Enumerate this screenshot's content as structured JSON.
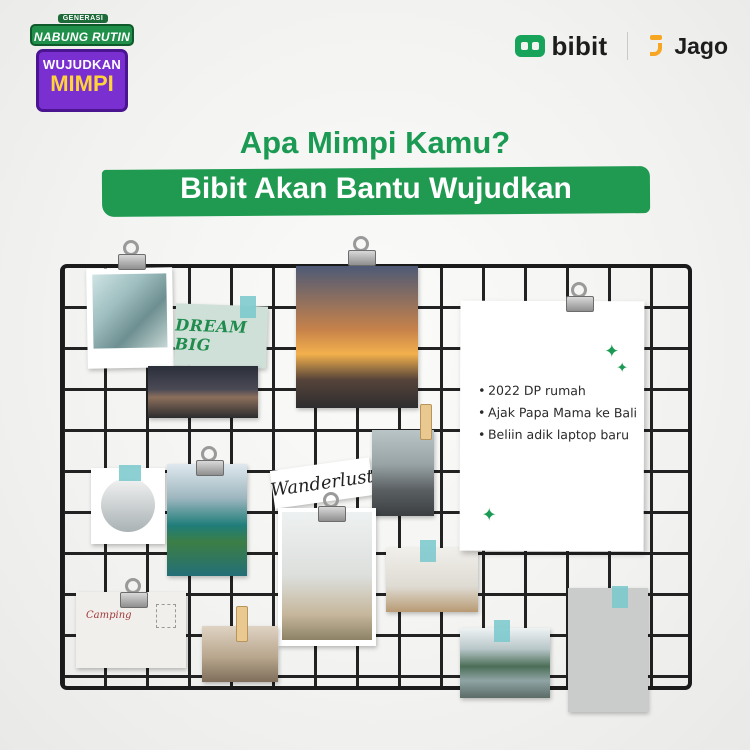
{
  "campaign": {
    "generasi": "GENERASI",
    "nabung_rutin": "NABUNG RUTIN",
    "wujudkan": "WUJUDKAN",
    "mimpi": "MIMPI"
  },
  "partners": {
    "bibit": "bibit",
    "jago": "Jago"
  },
  "headline": {
    "line1": "Apa Mimpi Kamu?",
    "line2": "Bibit Akan Bantu Wujudkan"
  },
  "board": {
    "dream_card": "DREAM BIG",
    "wanderlust_card": "Wanderlust",
    "postcard_stamp": "Camping"
  },
  "note": {
    "items": [
      "2022 DP rumah",
      "Ajak Papa Mama ke Bali",
      "Beliin adik laptop baru"
    ]
  },
  "colors": {
    "brand_green": "#1a9a52",
    "campaign_purple": "#7a2fd0",
    "jago_orange": "#f6a623"
  }
}
